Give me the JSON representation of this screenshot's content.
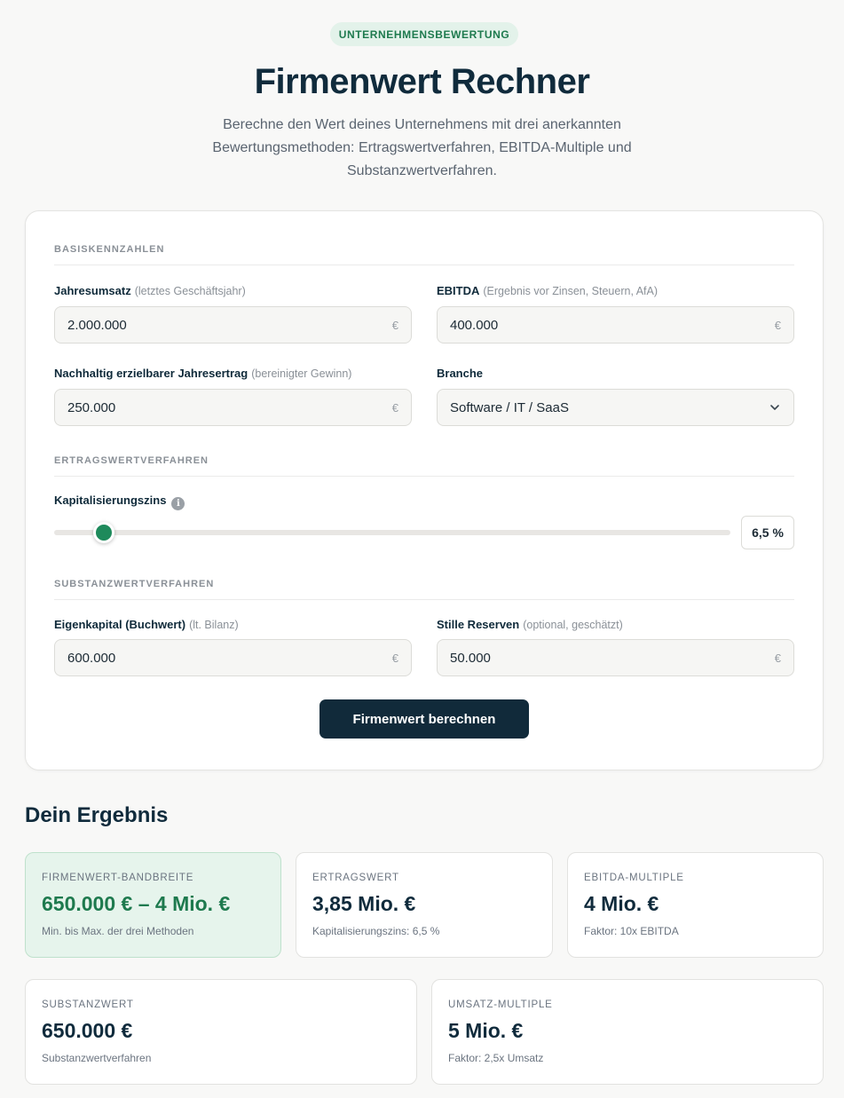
{
  "header": {
    "badge": "UNTERNEHMENSBEWERTUNG",
    "title": "Firmenwert Rechner",
    "subtitle": "Berechne den Wert deines Unternehmens mit drei anerkannten Bewertungsmethoden: Ertragswertverfahren, EBITDA-Multiple und Substanzwertverfahren."
  },
  "form": {
    "section_basis": "BASISKENNZAHLEN",
    "umsatz": {
      "label": "Jahresumsatz",
      "hint": "(letztes Geschäftsjahr)",
      "value": "2.000.000",
      "unit": "€"
    },
    "ebitda": {
      "label": "EBITDA",
      "hint": "(Ergebnis vor Zinsen, Steuern, AfA)",
      "value": "400.000",
      "unit": "€"
    },
    "ertrag": {
      "label": "Nachhaltig erzielbarer Jahresertrag",
      "hint": "(bereinigter Gewinn)",
      "value": "250.000",
      "unit": "€"
    },
    "branche": {
      "label": "Branche",
      "value": "Software / IT / SaaS"
    },
    "section_ertragswert": "ERTRAGSWERTVERFAHREN",
    "zins": {
      "label": "Kapitalisierungszins",
      "value": "6,5 %",
      "info_icon": "info-icon",
      "level_fraction": 0.075
    },
    "section_substanz": "SUBSTANZWERTVERFAHREN",
    "eigenkapital": {
      "label": "Eigenkapital (Buchwert)",
      "hint": "(lt. Bilanz)",
      "value": "600.000",
      "unit": "€"
    },
    "reserven": {
      "label": "Stille Reserven",
      "hint": "(optional, geschätzt)",
      "value": "50.000",
      "unit": "€"
    },
    "submit": "Firmenwert berechnen"
  },
  "results": {
    "title": "Dein Ergebnis",
    "accent": "#1e7a4e",
    "cards": [
      {
        "label": "FIRMENWERT-BANDBREITE",
        "value": "650.000 € – 4 Mio. €",
        "sub": "Min. bis Max. der drei Methoden"
      },
      {
        "label": "ERTRAGSWERT",
        "value": "3,85 Mio. €",
        "sub": "Kapitalisierungszins: 6,5 %"
      },
      {
        "label": "EBITDA-MULTIPLE",
        "value": "4 Mio. €",
        "sub": "Faktor: 10x EBITDA"
      },
      {
        "label": "SUBSTANZWERT",
        "value": "650.000 €",
        "sub": "Substanzwertverfahren"
      },
      {
        "label": "UMSATZ-MULTIPLE",
        "value": "5 Mio. €",
        "sub": "Faktor: 2,5x Umsatz"
      }
    ]
  }
}
